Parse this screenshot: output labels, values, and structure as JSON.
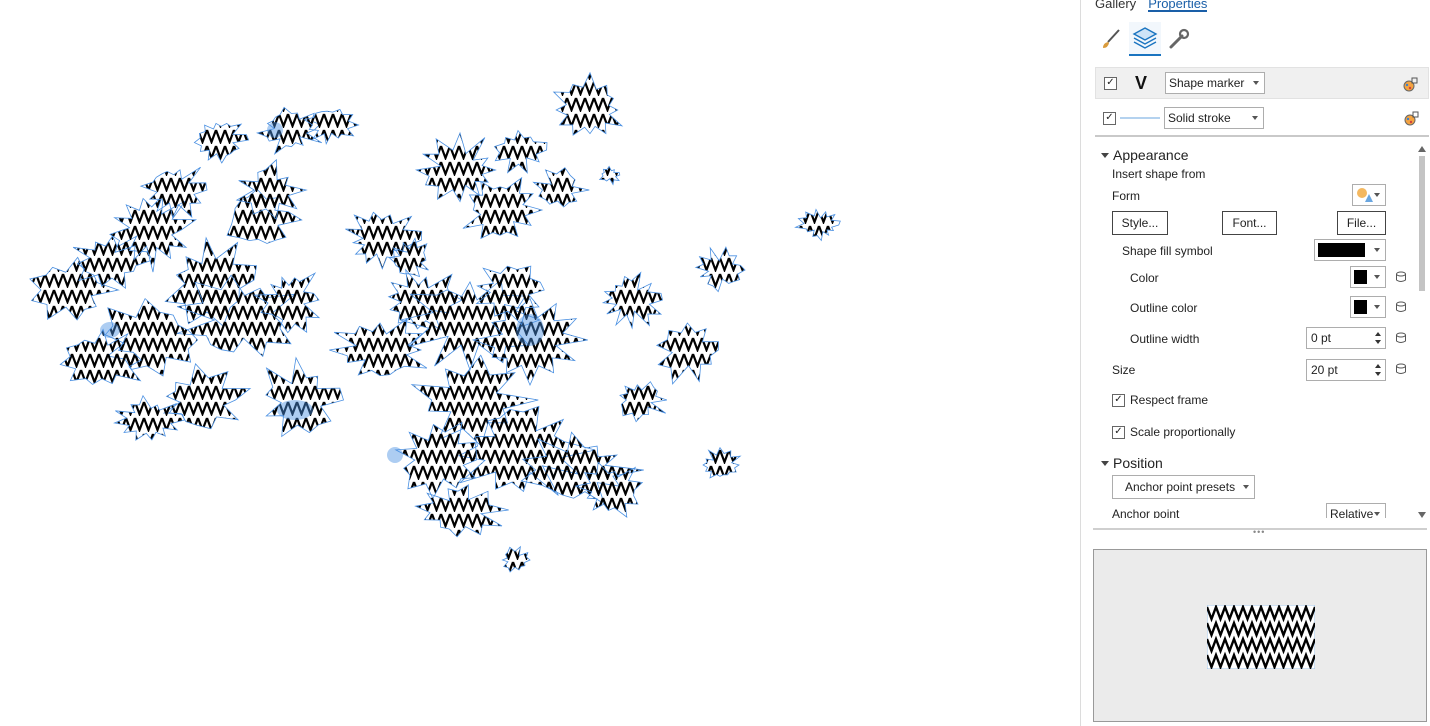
{
  "tabs": [
    {
      "label": "Gallery",
      "active": false
    },
    {
      "label": "Properties",
      "active": true
    }
  ],
  "tools": [
    {
      "icon": "paintbrush-icon",
      "active": false
    },
    {
      "icon": "layers-icon",
      "active": true
    },
    {
      "icon": "wrench-icon",
      "active": false
    }
  ],
  "layers": [
    {
      "glyph": "V",
      "type": "Shape marker",
      "checked": true,
      "selected": true
    },
    {
      "glyph": "",
      "type": "Solid stroke",
      "checked": true,
      "selected": false
    }
  ],
  "appearance": {
    "title": "Appearance",
    "insert_shape_from": "Insert shape from",
    "form_label": "Form",
    "style_button": "Style...",
    "font_button": "Font...",
    "file_button": "File...",
    "shape_fill_symbol": "Shape fill symbol",
    "color_label": "Color",
    "outline_color_label": "Outline color",
    "outline_width_label": "Outline width",
    "outline_width_value": "0 pt",
    "size_label": "Size",
    "size_value": "20 pt",
    "respect_frame": "Respect frame",
    "scale_proportionally": "Scale proportionally",
    "fill_color": "#000000",
    "outline_color": "#000000"
  },
  "position": {
    "title": "Position",
    "anchor_presets": "Anchor point presets",
    "anchor_point_label": "Anchor point",
    "anchor_point_value": "Relative"
  },
  "colors": {
    "accent": "#1a5fa8",
    "outline_blue": "#4a90e2",
    "stroke_blue": "#9cc3ea"
  }
}
